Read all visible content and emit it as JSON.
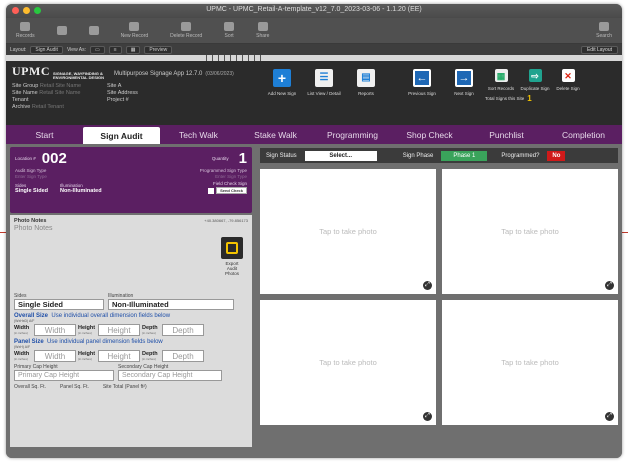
{
  "window": {
    "title": "UPMC - UPMC_Retail-A-template_v12_7.0_2023-03-06 - 1.1.20 (EE)"
  },
  "toolbar": {
    "items": [
      "Records",
      "",
      "",
      "New Record",
      "Delete Record",
      "Sort",
      "Share",
      "",
      "",
      "Search"
    ]
  },
  "layoutbar": {
    "layout": "Sign Audit",
    "view": "View As:",
    "preview": "Preview",
    "edit": "Edit Layout"
  },
  "header": {
    "brand": "UPMC",
    "division": "SIGNAGE, WAYFINDING & ENVIRONMENTAL DESIGN",
    "app": "Multipurpose Signage App 12.7.0",
    "version": "(03/06/2023)",
    "meta": [
      {
        "label": "Site Group",
        "value": "Retail Site Name"
      },
      {
        "label": "Site A",
        "value": ""
      },
      {
        "label": "Site Name",
        "value": "Retail Site Name"
      },
      {
        "label": "Site Address",
        "value": ""
      },
      {
        "label": "Tenant",
        "value": ""
      },
      {
        "label": "Project #",
        "value": ""
      },
      {
        "label": "Archive",
        "value": "Retail Tenant"
      },
      {
        "label": "",
        "value": ""
      }
    ],
    "buttons": {
      "add_new_sign": "Add New Sign",
      "list_view": "List View / Detail",
      "reports": "Reports",
      "prev_sign": "Previous Sign",
      "next_sign": "Next Sign",
      "sort_records": "Sort Records",
      "duplicate_sign": "Duplicate Sign",
      "delete_sign": "Delete Sign"
    },
    "total_signs_label": "Total Signs this Site",
    "total_signs": "1"
  },
  "tabs": [
    "Start",
    "Sign Audit",
    "Tech Walk",
    "Stake Walk",
    "Programming",
    "Shop Check",
    "Punchlist",
    "Completion"
  ],
  "active_tab": "Sign Audit",
  "location": {
    "label": "Location #",
    "number": "002",
    "qty_label": "Quantity",
    "qty": "1",
    "audit_type_label": "Audit Sign Type",
    "audit_type_placeholder": "Enter Sign Type",
    "programmed_type_label": "Programmed Sign Type",
    "programmed_type_placeholder": "Enter Sign Type",
    "sides_label": "Sides",
    "sides": "Single Sided",
    "illum_label": "Illumination",
    "illum": "Non-Illuminated",
    "field_check_label": "Field Check Sign",
    "field_check_btn": "Send Check"
  },
  "notes": {
    "title": "Photo Notes",
    "coord": "+40.380667, -79.856173",
    "placeholder": "Photo Notes",
    "export_label": "Export Audit Photos"
  },
  "form": {
    "sides_label": "Sides",
    "sides": "Single Sided",
    "illum_label": "Illumination",
    "illum": "Non-Illuminated",
    "overall_title": "Overall Size",
    "overall_sub": "Use individual overall dimension fields below",
    "overall_note": "(WxHxD) A/F",
    "panel_title": "Panel Size",
    "panel_sub": "Use individual panel dimension fields below",
    "panel_note": "(WxH) A/F",
    "width_label": "Width",
    "height_label": "Height",
    "depth_label": "Depth",
    "unit_note": "(in inches)",
    "width_ph": "Width",
    "height_ph": "Height",
    "depth_ph": "Depth",
    "primary_cap_label": "Primary Cap Height",
    "secondary_cap_label": "Secondary Cap Height",
    "primary_cap_ph": "Primary Cap Height",
    "secondary_cap_ph": "Secondary Cap Height",
    "overall_sqft": "Overall Sq. Ft.",
    "panel_sqft": "Panel Sq. Ft.",
    "site_total": "Site Total (Panel ft²)"
  },
  "status": {
    "sign_status_label": "Sign Status",
    "select": "Select...",
    "phase_label": "Sign Phase",
    "phase": "Phase 1",
    "programmed_label": "Programmed?",
    "programmed": "No"
  },
  "photos": [
    "Tap to take photo",
    "Tap to take photo",
    "Tap to take photo",
    "Tap to take photo"
  ],
  "colors": {
    "tab_bar": "#5b1f62",
    "phase": "#3aa35b",
    "no": "#d01a1a",
    "accent_blue": "#1e7fd6"
  }
}
